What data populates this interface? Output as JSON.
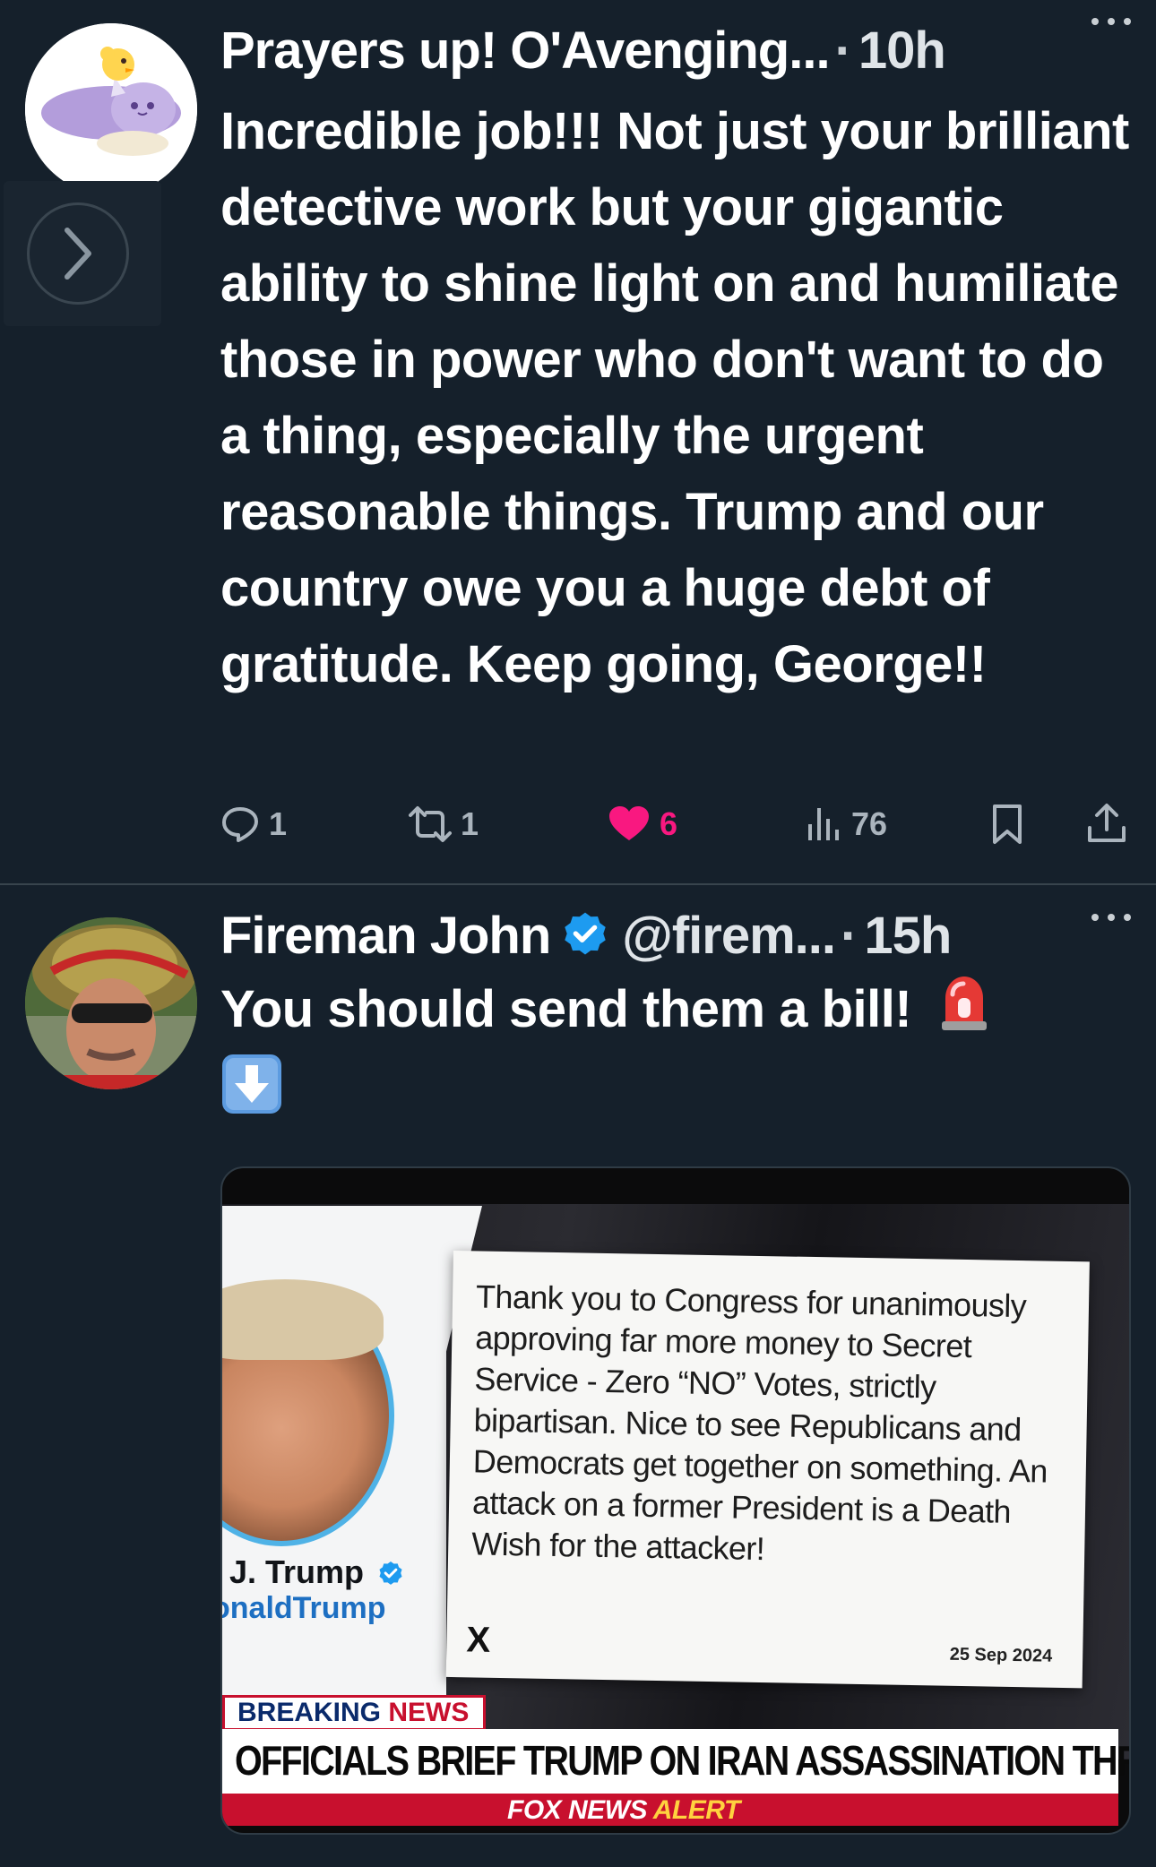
{
  "colors": {
    "background": "#15202b",
    "divider": "#38444d",
    "like_pink": "#f91880",
    "verified_blue": "#1d9bf0",
    "muted": "#aab4bd"
  },
  "tweets": [
    {
      "display_name": "Prayers up! O'Avenging...",
      "separator": "·",
      "time": "10h",
      "text": "Incredible job!!!  Not just your brilliant detective work but your gigantic ability to shine light on and humiliate those in power who don't want to do a thing, especially the urgent reasonable things.  Trump and our country owe you a huge debt of gratitude.  Keep going, George!!",
      "actions": {
        "replies": "1",
        "reposts": "1",
        "likes": "6",
        "views": "76"
      },
      "icons": [
        "reply-icon",
        "repost-icon",
        "heart-icon",
        "views-icon",
        "bookmark-icon",
        "share-icon",
        "more-icon",
        "chevron-right-icon"
      ]
    },
    {
      "display_name": "Fireman John",
      "handle": "@firem...",
      "separator": "·",
      "time": "15h",
      "text": "You should send them a bill!",
      "icons": [
        "verified-badge-icon",
        "siren-emoji-icon",
        "down-arrow-emoji-icon",
        "more-icon"
      ],
      "media": {
        "profile_name": "l J. Trump",
        "profile_handle": "onaldTrump",
        "quote": "Thank you to Congress for unanimously approving far more money to Secret Service - Zero “NO” Votes, strictly bipartisan. Nice to see Republicans and Democrats get together on something. An attack on a former President is a Death Wish for the attacker!",
        "quote_logo": "X",
        "quote_date": "25 Sep 2024",
        "breaking_word": "BREAKING",
        "news_word": "NEWS",
        "headline": "OFFICIALS BRIEF TRUMP ON IRAN ASSASSINATION THREAT",
        "network": "FOX NEWS",
        "alert_word": "ALERT"
      }
    }
  ]
}
